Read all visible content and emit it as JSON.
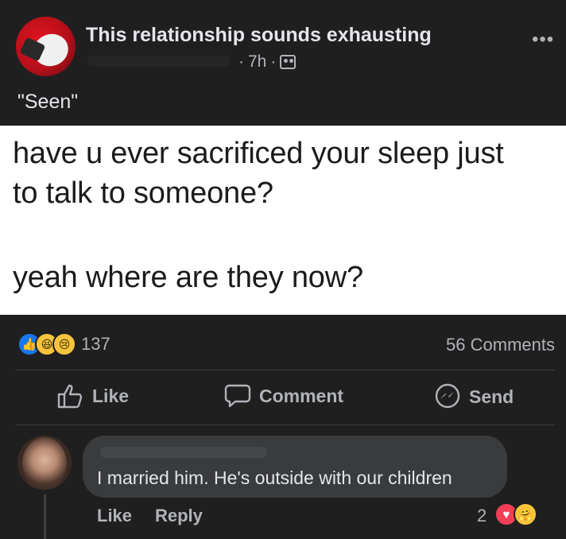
{
  "post": {
    "page_name": "This relationship sounds exhausting",
    "time": "7h",
    "separator": "·",
    "caption": "\"Seen\"",
    "more_icon": "more-options-icon"
  },
  "image": {
    "lines": [
      "have u ever sacrificed your sleep just",
      "to talk to someone?",
      "yeah where are they now?"
    ]
  },
  "engagement": {
    "reactions": [
      "like-reaction-icon",
      "haha-reaction-icon",
      "sad-reaction-icon"
    ],
    "reaction_count": "137",
    "comments_count": "56 Comments"
  },
  "actions": {
    "like": "Like",
    "comment": "Comment",
    "send": "Send"
  },
  "comment": {
    "text": "I married him. He's outside with our children",
    "like": "Like",
    "reply": "Reply",
    "reaction_count": "2",
    "reactions": [
      "love-reaction-icon",
      "care-reaction-icon"
    ]
  },
  "colors": {
    "background": "#1f1f20",
    "bubble": "#3a3b3c",
    "primary_text": "#e4e6eb",
    "secondary_text": "#b0b3b8",
    "like_blue": "#1877f2"
  }
}
